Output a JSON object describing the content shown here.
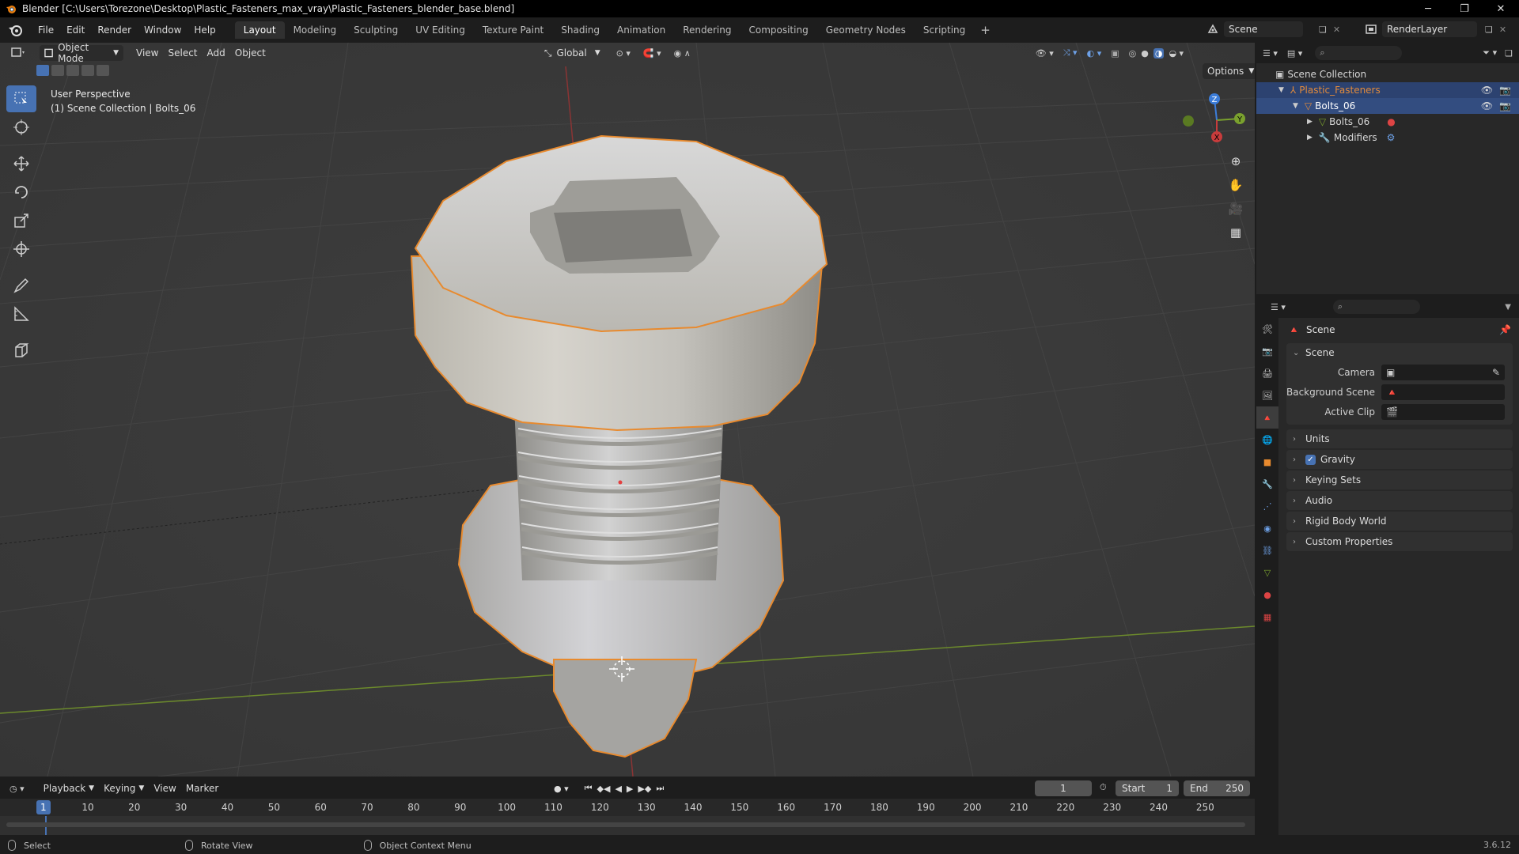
{
  "window": {
    "title": "Blender [C:\\Users\\Torezone\\Desktop\\Plastic_Fasteners_max_vray\\Plastic_Fasteners_blender_base.blend]",
    "minimize": "─",
    "maximize": "❐",
    "close": "✕"
  },
  "menu": [
    "File",
    "Edit",
    "Render",
    "Window",
    "Help"
  ],
  "workspaces": [
    {
      "label": "Layout",
      "active": true
    },
    {
      "label": "Modeling"
    },
    {
      "label": "Sculpting"
    },
    {
      "label": "UV Editing"
    },
    {
      "label": "Texture Paint"
    },
    {
      "label": "Shading"
    },
    {
      "label": "Animation"
    },
    {
      "label": "Rendering"
    },
    {
      "label": "Compositing"
    },
    {
      "label": "Geometry Nodes"
    },
    {
      "label": "Scripting"
    }
  ],
  "workspace_add": "+",
  "scene_selector": {
    "value": "Scene"
  },
  "render_layer": {
    "value": "RenderLayer"
  },
  "viewport_header": {
    "mode": "Object Mode",
    "view": "View",
    "select": "Select",
    "add": "Add",
    "object": "Object",
    "orientation": "Global",
    "options": "Options"
  },
  "viewport_info": {
    "line1": "User Perspective",
    "line2": "(1) Scene Collection | Bolts_06"
  },
  "gizmo": {
    "z": "Z",
    "y": "Y",
    "x": "X"
  },
  "outliner": {
    "root": "Scene Collection",
    "items": [
      {
        "label": "Plastic_Fasteners",
        "depth": 1,
        "expanded": true,
        "color": "#e08a3c"
      },
      {
        "label": "Bolts_06",
        "depth": 2,
        "expanded": true,
        "color": "#ffffff"
      },
      {
        "label": "Bolts_06",
        "depth": 3,
        "expanded": false,
        "color": "#d8d8d8"
      },
      {
        "label": "Modifiers",
        "depth": 3,
        "expanded": false,
        "color": "#d8d8d8"
      }
    ]
  },
  "properties": {
    "context": "Scene",
    "panel_title": "Scene",
    "fields": [
      {
        "label": "Camera",
        "value": ""
      },
      {
        "label": "Background Scene",
        "value": ""
      },
      {
        "label": "Active Clip",
        "value": ""
      }
    ],
    "subpanels": [
      "Units",
      "Gravity",
      "Keying Sets",
      "Audio",
      "Rigid Body World",
      "Custom Properties"
    ],
    "gravity_checked": true
  },
  "timeline": {
    "playback": "Playback",
    "keying": "Keying",
    "view": "View",
    "marker": "Marker",
    "current_frame": "1",
    "start_label": "Start",
    "start": "1",
    "end_label": "End",
    "end": "250",
    "ticks": [
      "10",
      "20",
      "30",
      "40",
      "50",
      "60",
      "70",
      "80",
      "90",
      "100",
      "110",
      "120",
      "130",
      "140",
      "150",
      "160",
      "170",
      "180",
      "190",
      "200",
      "210",
      "220",
      "230",
      "240",
      "250"
    ],
    "cursor_label": "1"
  },
  "statusbar": {
    "select": "Select",
    "rotate": "Rotate View",
    "context_menu": "Object Context Menu",
    "version": "3.6.12"
  },
  "colors": {
    "accent": "#4772b3",
    "selection_outline": "#e88a2e",
    "x_axis": "#c83c3c",
    "y_axis": "#7aa12e",
    "z_axis": "#3c7dd9"
  }
}
